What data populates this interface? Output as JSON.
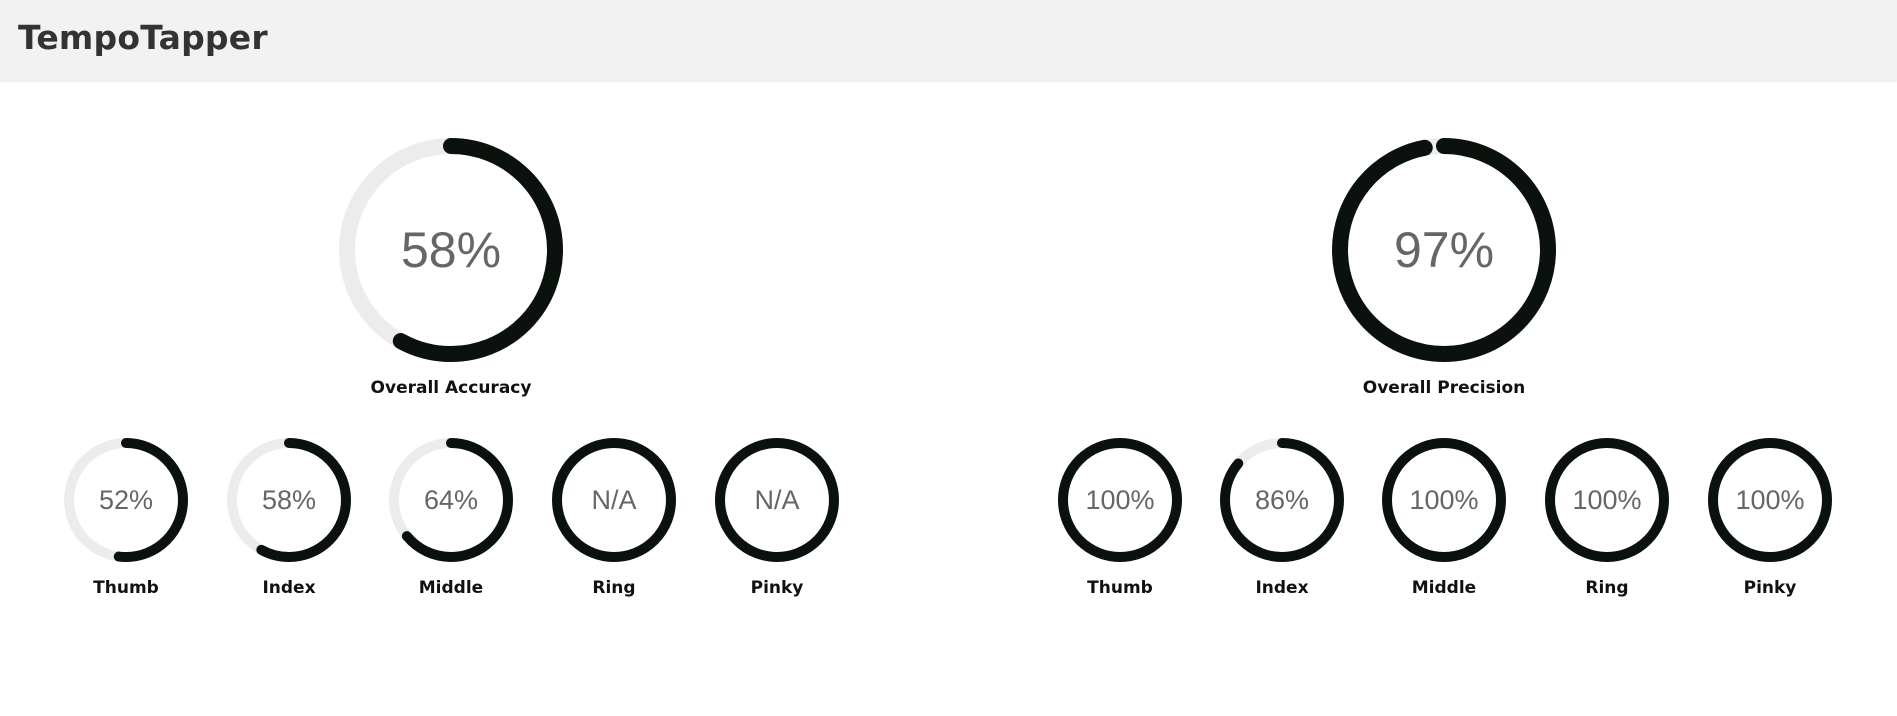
{
  "app": {
    "title": "TempoTapper"
  },
  "colors": {
    "track": "#ececec",
    "progress": "#0b120e",
    "value_text": "#666666"
  },
  "accuracy": {
    "overall": {
      "label": "Overall Accuracy",
      "display": "58%",
      "fraction": 0.58
    },
    "fingers": [
      {
        "label": "Thumb",
        "display": "52%",
        "fraction": 0.52
      },
      {
        "label": "Index",
        "display": "58%",
        "fraction": 0.58
      },
      {
        "label": "Middle",
        "display": "64%",
        "fraction": 0.64
      },
      {
        "label": "Ring",
        "display": "N/A",
        "fraction": 1.0
      },
      {
        "label": "Pinky",
        "display": "N/A",
        "fraction": 1.0
      }
    ]
  },
  "precision": {
    "overall": {
      "label": "Overall Precision",
      "display": "97%",
      "fraction": 0.97
    },
    "fingers": [
      {
        "label": "Thumb",
        "display": "100%",
        "fraction": 1.0
      },
      {
        "label": "Index",
        "display": "86%",
        "fraction": 0.86
      },
      {
        "label": "Middle",
        "display": "100%",
        "fraction": 1.0
      },
      {
        "label": "Ring",
        "display": "100%",
        "fraction": 1.0
      },
      {
        "label": "Pinky",
        "display": "100%",
        "fraction": 1.0
      }
    ]
  }
}
